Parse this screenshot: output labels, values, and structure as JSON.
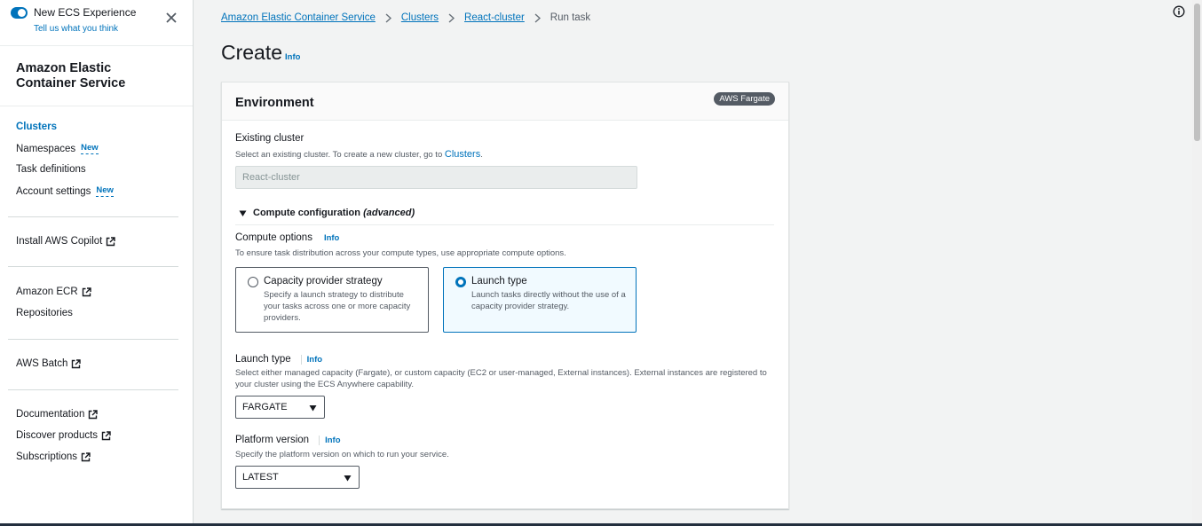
{
  "sidebar": {
    "experience_toggle_label": "New ECS Experience",
    "feedback_link": "Tell us what you think",
    "title": "Amazon Elastic Container Service",
    "items": [
      {
        "label": "Clusters"
      },
      {
        "label": "Namespaces",
        "badge": "New"
      },
      {
        "label": "Task definitions"
      },
      {
        "label": "Account settings",
        "badge": "New"
      },
      {
        "label": "Install AWS Copilot"
      },
      {
        "label": "Amazon ECR"
      },
      {
        "label": "Repositories"
      },
      {
        "label": "AWS Batch"
      },
      {
        "label": "Documentation"
      },
      {
        "label": "Discover products"
      },
      {
        "label": "Subscriptions"
      }
    ]
  },
  "breadcrumbs": [
    "Amazon Elastic Container Service",
    "Clusters",
    "React-cluster",
    "Run task"
  ],
  "page": {
    "title": "Create",
    "info": "Info"
  },
  "environment": {
    "title": "Environment",
    "badge": "AWS Fargate",
    "existing_cluster": {
      "label": "Existing cluster",
      "desc": "Select an existing cluster. To create a new cluster, go to",
      "desc_link": "Clusters",
      "desc_end": ".",
      "value": "React-cluster"
    },
    "compute_config_label": "Compute configuration",
    "compute_config_suffix": "(advanced)",
    "compute_options": {
      "label": "Compute options",
      "info": "Info",
      "desc": "To ensure task distribution across your compute types, use appropriate compute options.",
      "tiles": [
        {
          "title": "Capacity provider strategy",
          "desc": "Specify a launch strategy to distribute your tasks across one or more capacity providers."
        },
        {
          "title": "Launch type",
          "desc": "Launch tasks directly without the use of a capacity provider strategy."
        }
      ]
    },
    "launch_type": {
      "label": "Launch type",
      "info": "Info",
      "desc": "Select either managed capacity (Fargate), or custom capacity (EC2 or user-managed, External instances). External instances are registered to your cluster using the ECS Anywhere capability.",
      "value": "FARGATE"
    },
    "platform_version": {
      "label": "Platform version",
      "info": "Info",
      "desc": "Specify the platform version on which to run your service.",
      "value": "LATEST"
    }
  },
  "colors": {
    "accent": "#0073bb",
    "text": "#16191f",
    "muted": "#545b64",
    "background": "#f2f3f3"
  }
}
